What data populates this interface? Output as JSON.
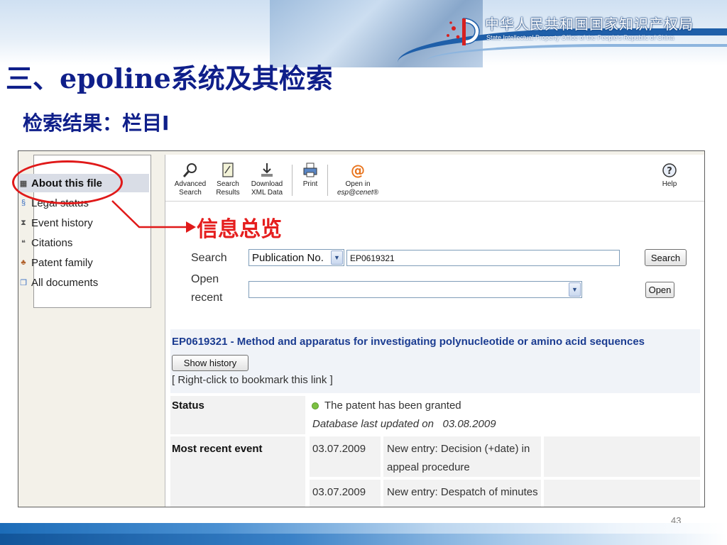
{
  "slide": {
    "title": "三、epoline系统及其检索",
    "subtitle": "检索结果：栏目I",
    "org_name_cn": "中华人民共和国国家知识产权局",
    "org_name_en": "State Intellectual Property Office of the People's Republic of China",
    "page_number": "43",
    "callout_text": "信息总览"
  },
  "sidebar": {
    "items": [
      {
        "label": "About this file",
        "icon": "grid-icon",
        "active": true
      },
      {
        "label": "Legal status",
        "icon": "section-icon"
      },
      {
        "label": "Event history",
        "icon": "hourglass-icon"
      },
      {
        "label": "Citations",
        "icon": "quote-icon"
      },
      {
        "label": "Patent family",
        "icon": "family-icon"
      },
      {
        "label": "All documents",
        "icon": "documents-icon"
      }
    ]
  },
  "toolbar": {
    "advanced_search": "Advanced Search",
    "search_results": "Search Results",
    "download_xml": "Download XML Data",
    "print": "Print",
    "open_in_1": "Open in",
    "open_in_2": "esp@cenet®",
    "help": "Help"
  },
  "search": {
    "label": "Search",
    "type_selected": "Publication No.",
    "value": "EP0619321",
    "button": "Search",
    "open_label": "Open recent",
    "open_value": "",
    "open_button": "Open"
  },
  "result": {
    "title": "EP0619321 - Method and apparatus for investigating polynucleotide or amino acid sequences",
    "show_history": "Show history",
    "bookmark_hint": "[ Right-click to bookmark this link ]",
    "status_label": "Status",
    "status_text": "The patent has been granted",
    "status_color": "#7cc142",
    "updated_text": "Database last updated on",
    "updated_date": "03.08.2009",
    "recent_event_label": "Most recent event",
    "events": [
      {
        "date": "03.07.2009",
        "text": "New entry: Decision (+date) in appeal procedure"
      },
      {
        "date": "03.07.2009",
        "text": "New entry: Despatch of minutes"
      }
    ]
  },
  "colors": {
    "title": "#0f1f8a",
    "callout": "#e51e1e",
    "link": "#1b3c91"
  }
}
